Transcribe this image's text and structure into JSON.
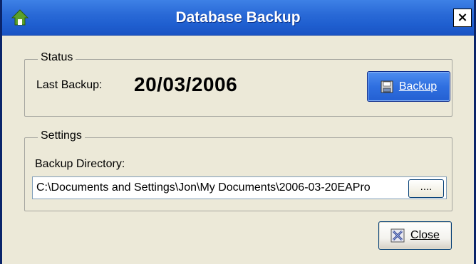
{
  "window": {
    "title": "Database Backup",
    "close_glyph": "×",
    "app_icon": "green-house-icon"
  },
  "status": {
    "legend": "Status",
    "last_backup_label": "Last Backup:",
    "last_backup_value": "20/03/2006",
    "backup_button": "Backup",
    "backup_icon": "floppy-disk-icon"
  },
  "settings": {
    "legend": "Settings",
    "directory_label": "Backup Directory:",
    "directory_value": "C:\\Documents and Settings\\Jon\\My Documents\\2006-03-20EAPro",
    "browse_button": "...."
  },
  "footer": {
    "close_button": "Close",
    "close_icon": "close-x-icon"
  },
  "colors": {
    "titlebar": "#2a6ad7",
    "dialog_bg": "#ece9d8",
    "accent_button": "#2f6fe0"
  }
}
